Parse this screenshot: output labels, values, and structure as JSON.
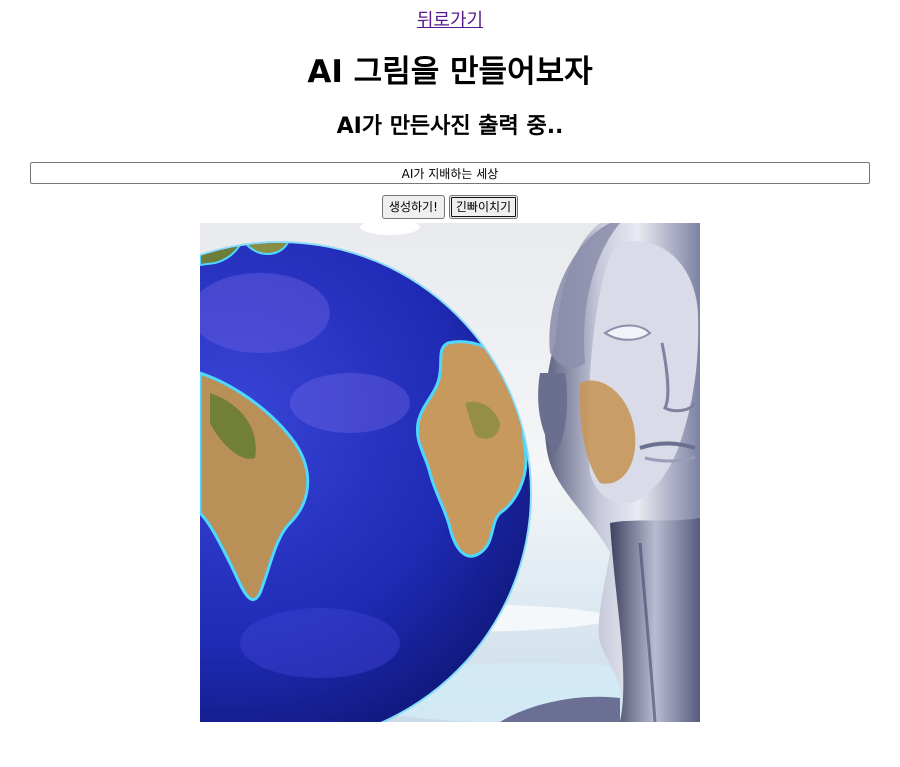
{
  "nav": {
    "back_label": "뒤로가기"
  },
  "header": {
    "title": "AI 그림을 만들어보자",
    "subtitle": "AI가 만든사진 출력 중.."
  },
  "prompt": {
    "value": "AI가 지배하는 세상"
  },
  "buttons": {
    "generate_label": "생성하기!",
    "joke_label": "긴빠이치기"
  },
  "result_image": {
    "description_icon": "ai-generated-image",
    "colors": {
      "ocean": "#1c2bb8",
      "land": "#c89a5e",
      "robot_metal": "#9aa0c0",
      "sky": "#dfe6ee"
    }
  }
}
